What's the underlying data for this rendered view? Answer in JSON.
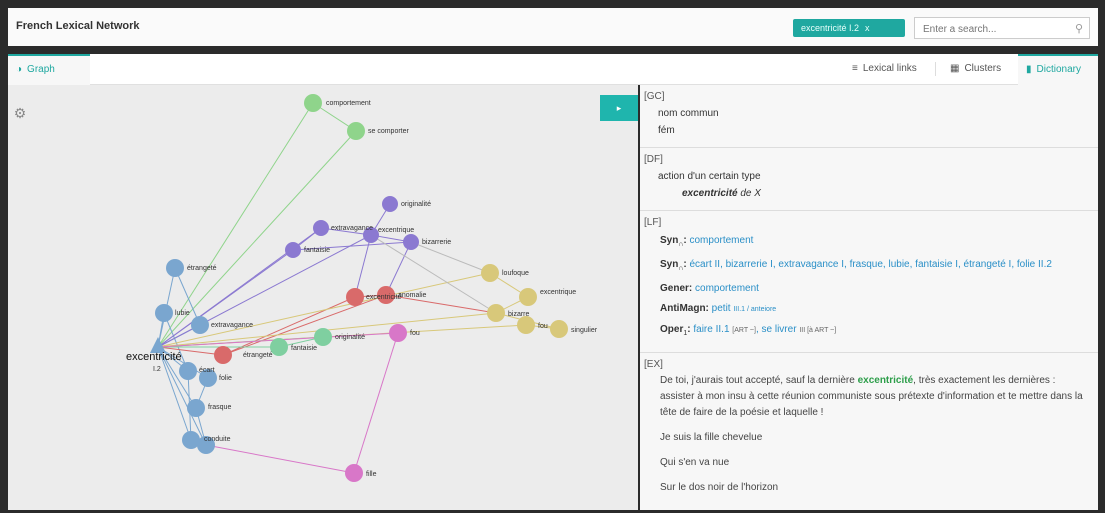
{
  "header": {
    "title": "French Lexical Network",
    "chip_label": "excentricité I.2",
    "chip_close": "x",
    "search_placeholder": "Enter a search..."
  },
  "tabs": {
    "graph": "Graph",
    "lexical_links": "Lexical links",
    "clusters": "Clusters",
    "dictionary": "Dictionary"
  },
  "colors": {
    "accent": "#1fa8a0",
    "blue": "#7aa6cf",
    "red": "#d96a6a",
    "green": "#8fd48b",
    "teal_green": "#7fcfa0",
    "purple": "#8b79d1",
    "yellow": "#d8c87a",
    "pink": "#d877c8",
    "link": "#2a8fc7"
  },
  "graph": {
    "center_label": "excentricité",
    "center_sublabel": "I.2",
    "nodes": [
      {
        "label": "comportement"
      },
      {
        "label": "se comporter"
      },
      {
        "label": "originalité"
      },
      {
        "label": "extravagance"
      },
      {
        "label": "excentrique"
      },
      {
        "label": "fantaisie"
      },
      {
        "label": "bizarrerie"
      },
      {
        "label": "étrangeté"
      },
      {
        "label": "loufoque"
      },
      {
        "label": "bizarre"
      },
      {
        "label": "excentrique"
      },
      {
        "label": "fou"
      },
      {
        "label": "singulier"
      },
      {
        "label": "excentricité"
      },
      {
        "label": "anomalie"
      },
      {
        "label": "fou"
      },
      {
        "label": "lubie"
      },
      {
        "label": "extravagance"
      },
      {
        "label": "étrangeté"
      },
      {
        "label": "écart"
      },
      {
        "label": "frasque"
      },
      {
        "label": "folie"
      },
      {
        "label": "fantaisie"
      },
      {
        "label": "fille"
      },
      {
        "label": "originalité"
      },
      {
        "label": "conduite"
      }
    ]
  },
  "dictionary": {
    "gc": {
      "tag": "[GC]",
      "line1": "nom commun",
      "line2": "fém"
    },
    "df": {
      "tag": "[DF]",
      "line1": "action d'un certain type",
      "line2_bold": "excentricité",
      "line2_rest": "de X"
    },
    "lf": {
      "tag": "[LF]",
      "syn1_name": "Syn",
      "syn1_sub": "∩",
      "syn1_value": "comportement",
      "syn2_name": "Syn",
      "syn2_sub": "∩",
      "syn2_value": "écart II, bizarrerie I, extravagance I, frasque, lubie, fantaisie I, étrangeté I, folie II.2",
      "gener_name": "Gener:",
      "gener_value": "comportement",
      "antimagn_name": "AntiMagn:",
      "antimagn_value": "petit",
      "antimagn_extra": "III.1 / anteiore",
      "oper_name": "Oper",
      "oper_sub": "1",
      "oper_value": "faire II.1",
      "oper_extra1": "[ART ~]",
      "oper_mid": ", se livrer",
      "oper_extra2": "III [à ART ~]"
    },
    "ex": {
      "tag": "[EX]",
      "p1_before": "De toi, j'aurais tout accepté, sauf la dernière ",
      "p1_hl": "excentricité",
      "p1_after": ", très exactement les dernières : assister à mon insu à cette réunion communiste sous prétexte d'information et te mettre dans la tête de faire de la poésie et laquelle !",
      "p2": "Je suis la fille chevelue",
      "p3": "Qui s'en va nue",
      "p4": "Sur le dos noir de l'horizon"
    }
  }
}
